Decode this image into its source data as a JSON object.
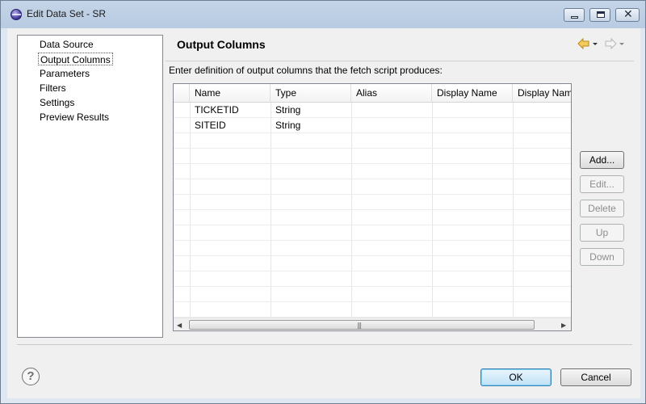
{
  "window": {
    "title": "Edit Data Set - SR"
  },
  "nav": {
    "items": [
      {
        "label": "Data Source"
      },
      {
        "label": "Output Columns"
      },
      {
        "label": "Parameters"
      },
      {
        "label": "Filters"
      },
      {
        "label": "Settings"
      },
      {
        "label": "Preview Results"
      }
    ],
    "selected": "Output Columns"
  },
  "page": {
    "title": "Output Columns",
    "description": "Enter definition of output columns that the fetch script produces:"
  },
  "table": {
    "columns": [
      "Name",
      "Type",
      "Alias",
      "Display Name",
      "Display Nam"
    ],
    "rows": [
      [
        "TICKETID",
        "String",
        "",
        "",
        ""
      ],
      [
        "SITEID",
        "String",
        "",
        "",
        ""
      ]
    ]
  },
  "buttons": {
    "add": "Add...",
    "edit": "Edit...",
    "delete": "Delete",
    "up": "Up",
    "down": "Down",
    "ok": "OK",
    "cancel": "Cancel"
  },
  "colors": {
    "titlebar": "#b8cbe2",
    "dialog_bg": "#f0f0f0",
    "back_arrow": "#e8b64a",
    "default_button_border": "#3c7fb1"
  },
  "icons": {
    "back": "arrow-left-icon",
    "forward": "arrow-right-icon",
    "help": "help-icon"
  }
}
